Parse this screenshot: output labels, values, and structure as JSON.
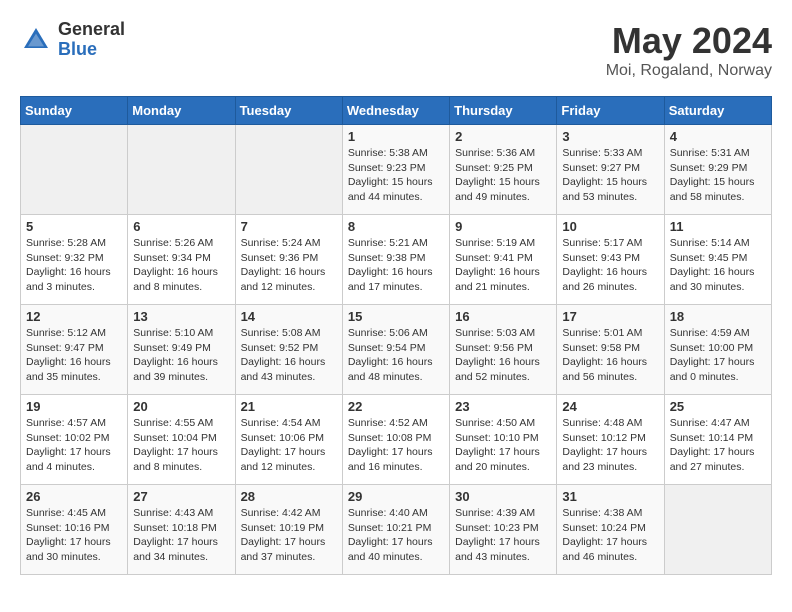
{
  "header": {
    "logo_general": "General",
    "logo_blue": "Blue",
    "title": "May 2024",
    "subtitle": "Moi, Rogaland, Norway"
  },
  "weekdays": [
    "Sunday",
    "Monday",
    "Tuesday",
    "Wednesday",
    "Thursday",
    "Friday",
    "Saturday"
  ],
  "weeks": [
    [
      {
        "day": "",
        "info": ""
      },
      {
        "day": "",
        "info": ""
      },
      {
        "day": "",
        "info": ""
      },
      {
        "day": "1",
        "info": "Sunrise: 5:38 AM\nSunset: 9:23 PM\nDaylight: 15 hours\nand 44 minutes."
      },
      {
        "day": "2",
        "info": "Sunrise: 5:36 AM\nSunset: 9:25 PM\nDaylight: 15 hours\nand 49 minutes."
      },
      {
        "day": "3",
        "info": "Sunrise: 5:33 AM\nSunset: 9:27 PM\nDaylight: 15 hours\nand 53 minutes."
      },
      {
        "day": "4",
        "info": "Sunrise: 5:31 AM\nSunset: 9:29 PM\nDaylight: 15 hours\nand 58 minutes."
      }
    ],
    [
      {
        "day": "5",
        "info": "Sunrise: 5:28 AM\nSunset: 9:32 PM\nDaylight: 16 hours\nand 3 minutes."
      },
      {
        "day": "6",
        "info": "Sunrise: 5:26 AM\nSunset: 9:34 PM\nDaylight: 16 hours\nand 8 minutes."
      },
      {
        "day": "7",
        "info": "Sunrise: 5:24 AM\nSunset: 9:36 PM\nDaylight: 16 hours\nand 12 minutes."
      },
      {
        "day": "8",
        "info": "Sunrise: 5:21 AM\nSunset: 9:38 PM\nDaylight: 16 hours\nand 17 minutes."
      },
      {
        "day": "9",
        "info": "Sunrise: 5:19 AM\nSunset: 9:41 PM\nDaylight: 16 hours\nand 21 minutes."
      },
      {
        "day": "10",
        "info": "Sunrise: 5:17 AM\nSunset: 9:43 PM\nDaylight: 16 hours\nand 26 minutes."
      },
      {
        "day": "11",
        "info": "Sunrise: 5:14 AM\nSunset: 9:45 PM\nDaylight: 16 hours\nand 30 minutes."
      }
    ],
    [
      {
        "day": "12",
        "info": "Sunrise: 5:12 AM\nSunset: 9:47 PM\nDaylight: 16 hours\nand 35 minutes."
      },
      {
        "day": "13",
        "info": "Sunrise: 5:10 AM\nSunset: 9:49 PM\nDaylight: 16 hours\nand 39 minutes."
      },
      {
        "day": "14",
        "info": "Sunrise: 5:08 AM\nSunset: 9:52 PM\nDaylight: 16 hours\nand 43 minutes."
      },
      {
        "day": "15",
        "info": "Sunrise: 5:06 AM\nSunset: 9:54 PM\nDaylight: 16 hours\nand 48 minutes."
      },
      {
        "day": "16",
        "info": "Sunrise: 5:03 AM\nSunset: 9:56 PM\nDaylight: 16 hours\nand 52 minutes."
      },
      {
        "day": "17",
        "info": "Sunrise: 5:01 AM\nSunset: 9:58 PM\nDaylight: 16 hours\nand 56 minutes."
      },
      {
        "day": "18",
        "info": "Sunrise: 4:59 AM\nSunset: 10:00 PM\nDaylight: 17 hours\nand 0 minutes."
      }
    ],
    [
      {
        "day": "19",
        "info": "Sunrise: 4:57 AM\nSunset: 10:02 PM\nDaylight: 17 hours\nand 4 minutes."
      },
      {
        "day": "20",
        "info": "Sunrise: 4:55 AM\nSunset: 10:04 PM\nDaylight: 17 hours\nand 8 minutes."
      },
      {
        "day": "21",
        "info": "Sunrise: 4:54 AM\nSunset: 10:06 PM\nDaylight: 17 hours\nand 12 minutes."
      },
      {
        "day": "22",
        "info": "Sunrise: 4:52 AM\nSunset: 10:08 PM\nDaylight: 17 hours\nand 16 minutes."
      },
      {
        "day": "23",
        "info": "Sunrise: 4:50 AM\nSunset: 10:10 PM\nDaylight: 17 hours\nand 20 minutes."
      },
      {
        "day": "24",
        "info": "Sunrise: 4:48 AM\nSunset: 10:12 PM\nDaylight: 17 hours\nand 23 minutes."
      },
      {
        "day": "25",
        "info": "Sunrise: 4:47 AM\nSunset: 10:14 PM\nDaylight: 17 hours\nand 27 minutes."
      }
    ],
    [
      {
        "day": "26",
        "info": "Sunrise: 4:45 AM\nSunset: 10:16 PM\nDaylight: 17 hours\nand 30 minutes."
      },
      {
        "day": "27",
        "info": "Sunrise: 4:43 AM\nSunset: 10:18 PM\nDaylight: 17 hours\nand 34 minutes."
      },
      {
        "day": "28",
        "info": "Sunrise: 4:42 AM\nSunset: 10:19 PM\nDaylight: 17 hours\nand 37 minutes."
      },
      {
        "day": "29",
        "info": "Sunrise: 4:40 AM\nSunset: 10:21 PM\nDaylight: 17 hours\nand 40 minutes."
      },
      {
        "day": "30",
        "info": "Sunrise: 4:39 AM\nSunset: 10:23 PM\nDaylight: 17 hours\nand 43 minutes."
      },
      {
        "day": "31",
        "info": "Sunrise: 4:38 AM\nSunset: 10:24 PM\nDaylight: 17 hours\nand 46 minutes."
      },
      {
        "day": "",
        "info": ""
      }
    ]
  ]
}
